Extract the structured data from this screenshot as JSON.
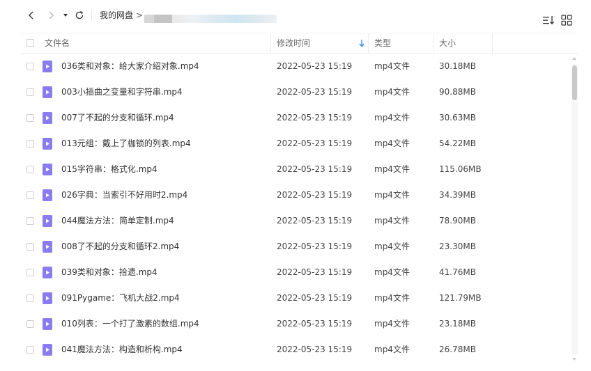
{
  "breadcrumb": {
    "root": "我的网盘",
    "separator": ">"
  },
  "header": {
    "name": "文件名",
    "modified": "修改时间",
    "type": "类型",
    "size": "大小"
  },
  "files": [
    {
      "name": "036类和对象：给大家介绍对象.mp4",
      "modified": "2022-05-23 15:19",
      "type": "mp4文件",
      "size": "30.18MB"
    },
    {
      "name": "003小插曲之变量和字符串.mp4",
      "modified": "2022-05-23 15:19",
      "type": "mp4文件",
      "size": "90.88MB"
    },
    {
      "name": "007了不起的分支和循环.mp4",
      "modified": "2022-05-23 15:19",
      "type": "mp4文件",
      "size": "30.63MB"
    },
    {
      "name": "013元组：戴上了枷锁的列表.mp4",
      "modified": "2022-05-23 15:19",
      "type": "mp4文件",
      "size": "54.22MB"
    },
    {
      "name": "015字符串：格式化.mp4",
      "modified": "2022-05-23 15:19",
      "type": "mp4文件",
      "size": "115.06MB"
    },
    {
      "name": "026字典：当索引不好用时2.mp4",
      "modified": "2022-05-23 15:19",
      "type": "mp4文件",
      "size": "34.39MB"
    },
    {
      "name": "044魔法方法：简单定制.mp4",
      "modified": "2022-05-23 15:19",
      "type": "mp4文件",
      "size": "78.90MB"
    },
    {
      "name": "008了不起的分支和循环2.mp4",
      "modified": "2022-05-23 15:19",
      "type": "mp4文件",
      "size": "23.30MB"
    },
    {
      "name": "039类和对象：拾遗.mp4",
      "modified": "2022-05-23 15:19",
      "type": "mp4文件",
      "size": "41.76MB"
    },
    {
      "name": "091Pygame：飞机大战2.mp4",
      "modified": "2022-05-23 15:19",
      "type": "mp4文件",
      "size": "121.79MB"
    },
    {
      "name": "010列表：一个打了激素的数组.mp4",
      "modified": "2022-05-23 15:19",
      "type": "mp4文件",
      "size": "23.18MB"
    },
    {
      "name": "041魔法方法：构造和析构.mp4",
      "modified": "2022-05-23 15:19",
      "type": "mp4文件",
      "size": "26.78MB"
    }
  ],
  "colors": {
    "file_icon": "#8a7cf0",
    "sort_arrow": "#2d8cf0"
  },
  "icons": {
    "back": "chevron-left-icon",
    "forward": "chevron-right-icon",
    "dropdown": "caret-down-icon",
    "refresh": "refresh-icon",
    "sort": "sort-list-icon",
    "grid": "grid-view-icon",
    "file": "video-file-icon"
  }
}
